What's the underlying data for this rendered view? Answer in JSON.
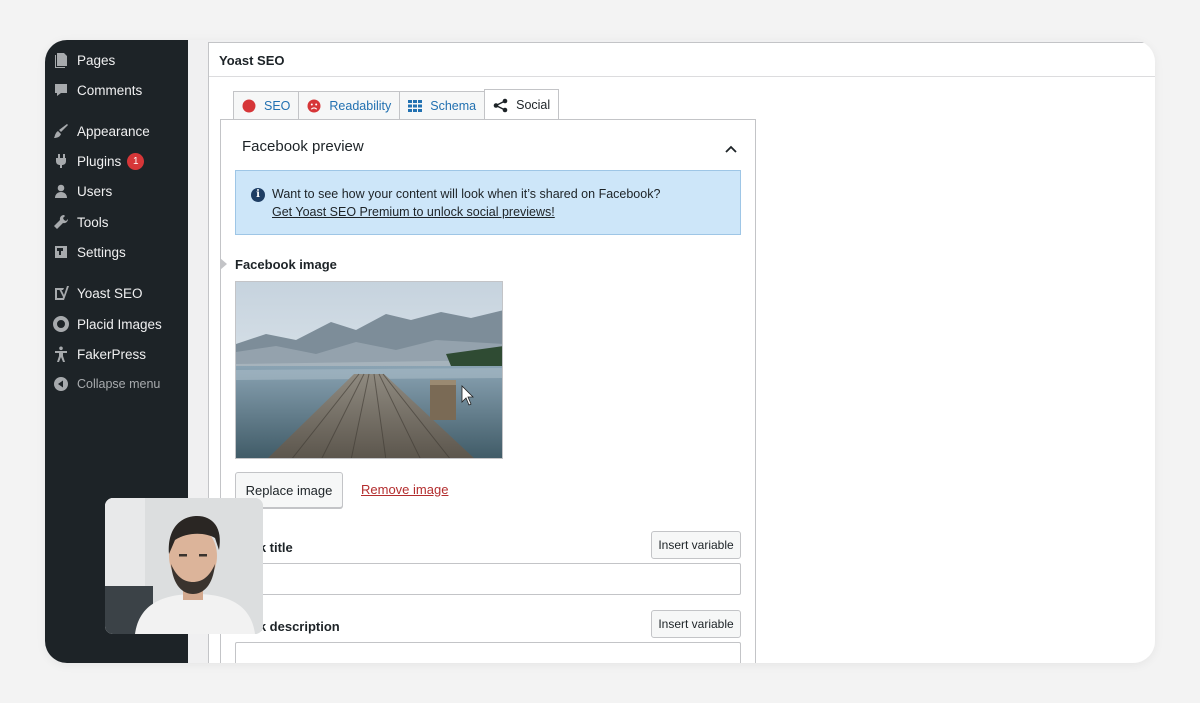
{
  "sidebar": {
    "items": [
      {
        "label": "Pages",
        "icon": "pages-icon"
      },
      {
        "label": "Comments",
        "icon": "comments-icon"
      },
      {
        "label": "Appearance",
        "icon": "appearance-icon"
      },
      {
        "label": "Plugins",
        "icon": "plugins-icon",
        "badge": "1"
      },
      {
        "label": "Users",
        "icon": "users-icon"
      },
      {
        "label": "Tools",
        "icon": "tools-icon"
      },
      {
        "label": "Settings",
        "icon": "settings-icon"
      },
      {
        "label": "Yoast SEO",
        "icon": "yoast-icon"
      },
      {
        "label": "Placid Images",
        "icon": "placid-icon"
      },
      {
        "label": "FakerPress",
        "icon": "fakerpress-icon"
      }
    ],
    "collapse_label": "Collapse menu"
  },
  "panel": {
    "title": "Yoast SEO",
    "tabs": [
      {
        "label": "SEO",
        "icon": "seo-score-icon",
        "color": "#d63638"
      },
      {
        "label": "Readability",
        "icon": "readability-sad-icon",
        "color": "#d63638"
      },
      {
        "label": "Schema",
        "icon": "schema-grid-icon",
        "color": "#2271b1"
      },
      {
        "label": "Social",
        "icon": "share-icon",
        "active": true
      }
    ]
  },
  "facebook": {
    "preview_title": "Facebook preview",
    "notice_text": "Want to see how your content will look when it’s shared on Facebook?",
    "notice_link": "Get Yoast SEO Premium to unlock social previews!",
    "image_label": "Facebook image",
    "replace_label": "Replace image",
    "remove_label": "Remove image",
    "title_label": "book title",
    "title_insert": "Insert variable",
    "desc_label": "book description",
    "desc_insert": "Insert variable"
  }
}
